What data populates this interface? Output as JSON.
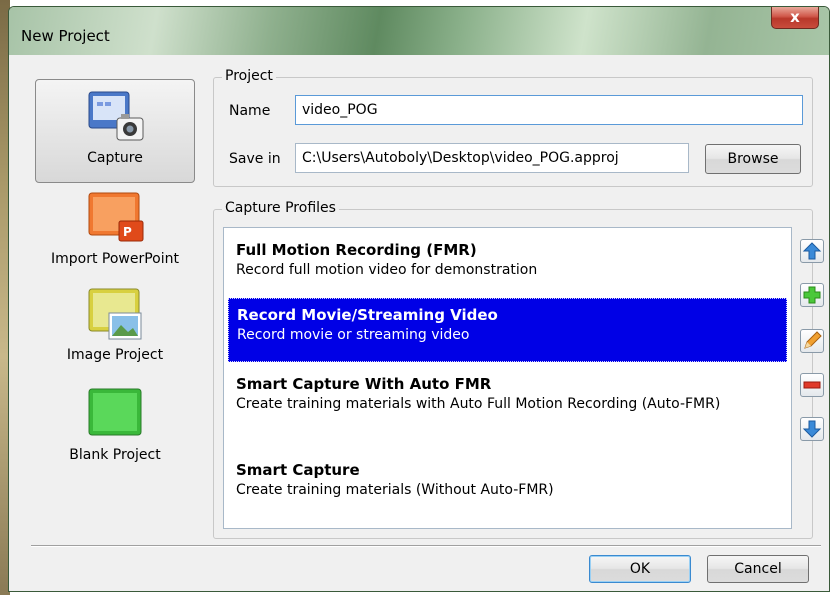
{
  "window": {
    "title": "New Project",
    "close_label": "x"
  },
  "categories": [
    {
      "label": "Capture",
      "icon": "capture-icon",
      "selected": true
    },
    {
      "label": "Import PowerPoint",
      "icon": "powerpoint-icon",
      "selected": false
    },
    {
      "label": "Image Project",
      "icon": "image-project-icon",
      "selected": false
    },
    {
      "label": "Blank Project",
      "icon": "blank-project-icon",
      "selected": false
    }
  ],
  "project": {
    "group_title": "Project",
    "name_label": "Name",
    "name_value": "video_POG",
    "save_in_label": "Save in",
    "save_in_value": "C:\\Users\\Autoboly\\Desktop\\video_POG.approj",
    "browse_label": "Browse"
  },
  "capture_profiles": {
    "group_title": "Capture Profiles",
    "items": [
      {
        "name": "Full Motion Recording (FMR)",
        "description": "Record full motion video for demonstration",
        "selected": false
      },
      {
        "name": "Record Movie/Streaming Video",
        "description": "Record movie or streaming video",
        "selected": true
      },
      {
        "name": "Smart Capture With Auto FMR",
        "description": "Create training materials with Auto Full Motion Recording (Auto-FMR)",
        "selected": false
      },
      {
        "name": "Smart Capture",
        "description": "Create training materials (Without Auto-FMR)",
        "selected": false
      }
    ],
    "side_buttons": [
      "move-up-icon",
      "add-icon",
      "edit-icon",
      "remove-icon",
      "move-down-icon"
    ]
  },
  "footer": {
    "ok_label": "OK",
    "cancel_label": "Cancel"
  },
  "colors": {
    "selection": "#0000e6",
    "title_bar": "#8fb08e",
    "close": "#c94c3c"
  }
}
